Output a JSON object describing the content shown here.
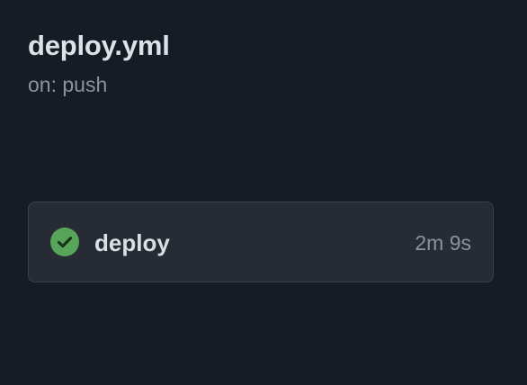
{
  "workflow": {
    "title": "deploy.yml",
    "trigger": "on: push"
  },
  "jobs": [
    {
      "name": "deploy",
      "duration": "2m 9s",
      "status": "success",
      "status_icon": "check-circle-icon",
      "status_color": "#57a55a"
    }
  ],
  "colors": {
    "background": "#171b23",
    "card": "#272b33",
    "card_border": "#3a4049",
    "muted_text": "#8b949e"
  }
}
